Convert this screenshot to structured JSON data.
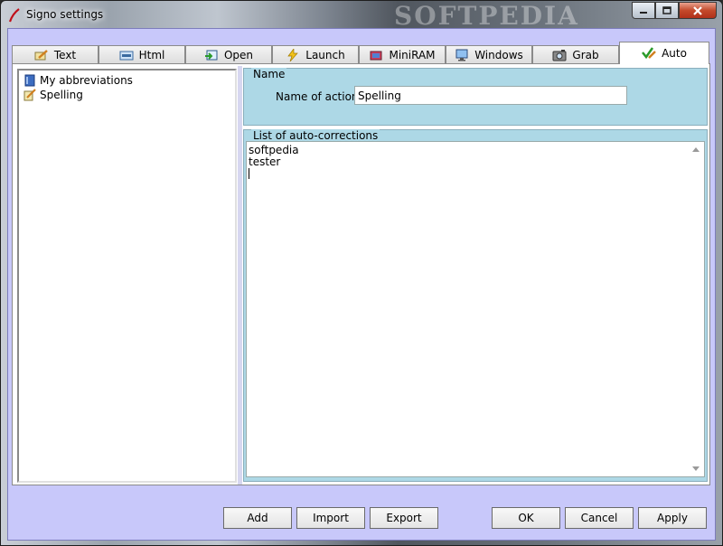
{
  "window": {
    "title": "Signo settings",
    "watermark": "SOFTPEDIA",
    "accent": "#c8c8fa",
    "close_color": "#c44a2b"
  },
  "tabs": [
    {
      "label": "Text",
      "icon": "pencil-paper-icon",
      "active": false
    },
    {
      "label": "Html",
      "icon": "html-icon",
      "active": false
    },
    {
      "label": "Open",
      "icon": "open-arrow-icon",
      "active": false
    },
    {
      "label": "Launch",
      "icon": "lightning-icon",
      "active": false
    },
    {
      "label": "MiniRAM",
      "icon": "ram-chip-icon",
      "active": false
    },
    {
      "label": "Windows",
      "icon": "monitor-icon",
      "active": false
    },
    {
      "label": "Grab",
      "icon": "camera-icon",
      "active": false
    },
    {
      "label": "Auto",
      "icon": "check-pencil-icon",
      "active": true
    }
  ],
  "tree": {
    "items": [
      {
        "label": "My abbreviations",
        "icon": "book-icon"
      },
      {
        "label": "Spelling",
        "icon": "notepad-pencil-icon"
      }
    ]
  },
  "name_group": {
    "legend": "Name",
    "label": "Name of action:",
    "value": "Spelling"
  },
  "list_group": {
    "legend": "List of auto-corrections",
    "lines": [
      "softpedia",
      "tester"
    ]
  },
  "buttons": {
    "add": "Add",
    "import": "Import",
    "export": "Export",
    "ok": "OK",
    "cancel": "Cancel",
    "apply": "Apply"
  }
}
